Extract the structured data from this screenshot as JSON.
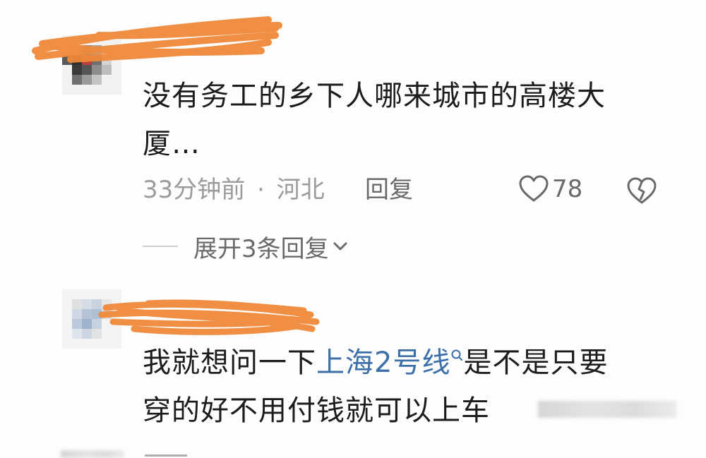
{
  "comments": [
    {
      "text": "没有务工的乡下人哪来城市的高楼大厦…",
      "line1": "没有务工的乡下人哪来城市的高楼大",
      "line2": "厦…",
      "time": "33分钟前",
      "separator": "·",
      "location": "河北",
      "reply_label": "回复",
      "likes": "78",
      "expand_replies": "展开3条回复"
    },
    {
      "text": "我就想问一下上海2号线是不是只要穿的好不用付钱就可以上车",
      "line1_prefix": "我就想问一下",
      "line1_link": "上海2号线",
      "line1_suffix": "是不是只要",
      "line2": "穿的好不用付钱就可以上车"
    }
  ],
  "colors": {
    "scribble": "#f08a3a",
    "link": "#3d6fa8",
    "meta": "#9b9b9b"
  },
  "icons": [
    "heart-outline-icon",
    "broken-heart-icon",
    "chevron-down-icon",
    "search-icon"
  ]
}
